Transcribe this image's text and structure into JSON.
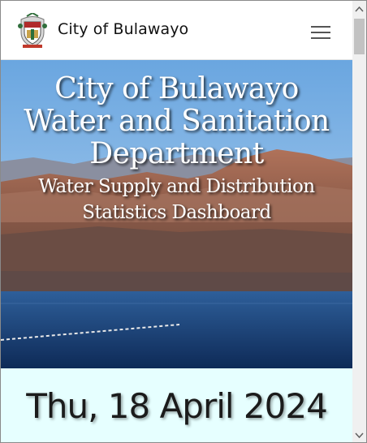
{
  "navbar": {
    "brand": "City of Bulawayo",
    "logo_icon": "city-crest-icon",
    "menu_icon": "hamburger-menu-icon"
  },
  "hero": {
    "title_line1": "City of Bulawayo",
    "title_line2": "Water and Sanitation",
    "title_line3": "Department",
    "subtitle_line1": "Water Supply and Distribution",
    "subtitle_line2": "Statistics Dashboard"
  },
  "date": {
    "text": "Thu, 18 April 2024"
  },
  "colors": {
    "date_panel_bg": "#e6ffff",
    "navbar_bg": "#ffffff"
  },
  "scrollbar": {
    "up_icon": "scroll-up-arrow-icon",
    "down_icon": "scroll-down-arrow-icon"
  }
}
